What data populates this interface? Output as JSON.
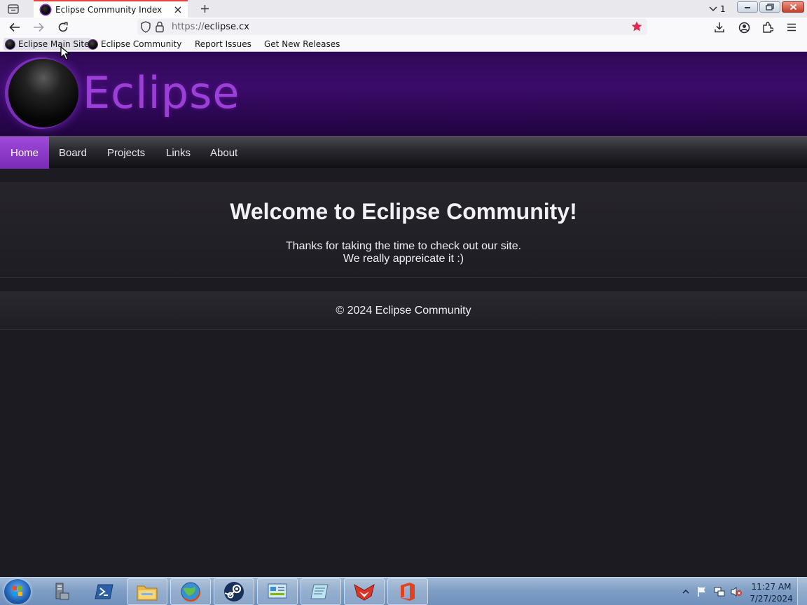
{
  "browser": {
    "tab": {
      "title": "Eclipse Community Index"
    },
    "tab_count": "1",
    "url": {
      "protocol": "https://",
      "host": "eclipse.cx"
    },
    "bookmarks": [
      {
        "label": "Eclipse Main Site"
      },
      {
        "label": "Eclipse Community"
      },
      {
        "label": "Report Issues"
      },
      {
        "label": "Get New Releases"
      }
    ]
  },
  "site": {
    "logo_text": "Eclipse",
    "nav": [
      {
        "label": "Home"
      },
      {
        "label": "Board"
      },
      {
        "label": "Projects"
      },
      {
        "label": "Links"
      },
      {
        "label": "About"
      }
    ],
    "active_nav": "Home",
    "welcome_heading": "Welcome to Eclipse Community!",
    "thanks_line1": "Thanks for taking the time to check out our site.",
    "thanks_line2": "We really appreicate it :)",
    "copyright": "© 2024 Eclipse Community"
  },
  "taskbar": {
    "apps": [
      "server-manager-icon",
      "powershell-icon",
      "file-explorer-icon",
      "browser-globe-icon",
      "steam-icon",
      "control-panel-icon",
      "notepad-icon",
      "fox-app-icon",
      "office-icon"
    ],
    "clock_time": "11:27 AM",
    "clock_date": "7/27/2024"
  },
  "colors": {
    "accent_purple": "#9b3fd8",
    "active_tab_border": "#e6413b",
    "bookmark_star": "#e22850",
    "page_background": "#1c1b22"
  }
}
